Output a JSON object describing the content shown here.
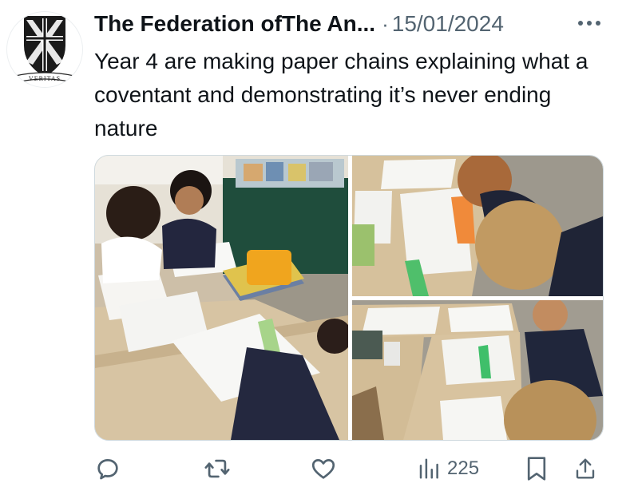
{
  "tweet": {
    "author_name": "The Federation ofThe An...",
    "separator": "·",
    "date": "15/01/2024",
    "text": "Year 4 are making paper chains explaining what a coventant and demonstrating it’s never ending nature",
    "avatar": {
      "icon": "school-crest-icon",
      "motto": "VERITAS"
    },
    "media": {
      "count": 3,
      "photos": [
        {
          "name": "photo-children-writing-at-table",
          "icon": "photo"
        },
        {
          "name": "photo-pupils-writing-closeup",
          "icon": "photo"
        },
        {
          "name": "photo-classroom-tables-paper-strips",
          "icon": "photo"
        }
      ]
    },
    "actions": {
      "reply_icon": "reply-icon",
      "retweet_icon": "retweet-icon",
      "like_icon": "heart-icon",
      "views_icon": "views-chart-icon",
      "views": "225",
      "bookmark_icon": "bookmark-icon",
      "share_icon": "share-icon"
    },
    "colors": {
      "text": "#0f1419",
      "muted": "#536471",
      "border": "#cfd9de"
    }
  }
}
